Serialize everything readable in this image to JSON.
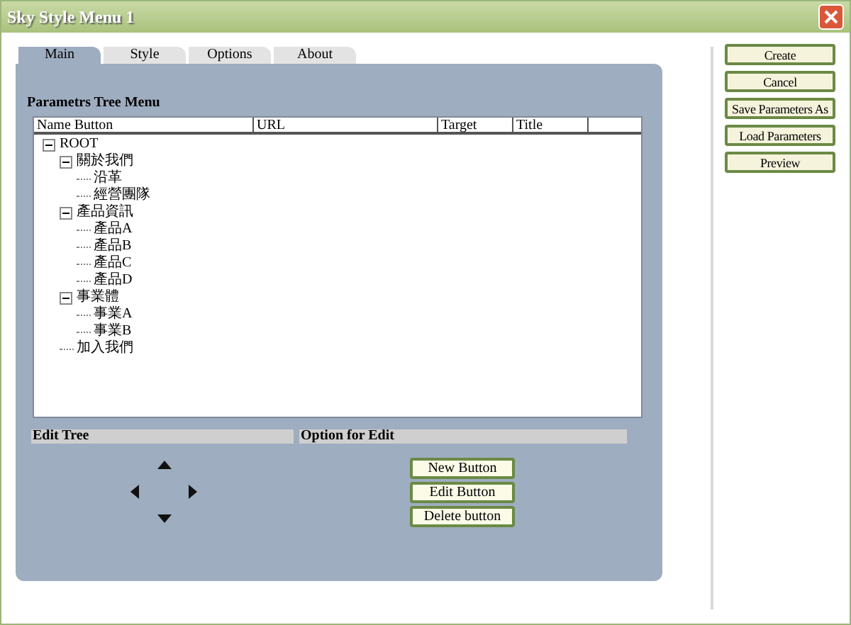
{
  "window": {
    "title": "Sky Style Menu 1"
  },
  "tabs": [
    {
      "label": "Main",
      "selected": true
    },
    {
      "label": "Style",
      "selected": false
    },
    {
      "label": "Options",
      "selected": false
    },
    {
      "label": "About",
      "selected": false
    }
  ],
  "tree_panel": {
    "title": "Parametrs Tree Menu",
    "columns": [
      "Name Button",
      "URL",
      "Target",
      "Title"
    ],
    "tree": [
      {
        "label": "ROOT",
        "expanded": true,
        "children": [
          {
            "label": "關於我們",
            "expanded": true,
            "children": [
              {
                "label": "沿革"
              },
              {
                "label": "經營團隊"
              }
            ]
          },
          {
            "label": "產品資訊",
            "expanded": true,
            "children": [
              {
                "label": "產品A"
              },
              {
                "label": "產品B"
              },
              {
                "label": "產品C"
              },
              {
                "label": "產品D"
              }
            ]
          },
          {
            "label": "事業體",
            "expanded": true,
            "children": [
              {
                "label": "事業A"
              },
              {
                "label": "事業B"
              }
            ]
          },
          {
            "label": "加入我們"
          }
        ]
      }
    ]
  },
  "edit_tree": {
    "title": "Edit Tree"
  },
  "option_for_edit": {
    "title": "Option for Edit",
    "buttons": [
      "New Button",
      "Edit Button",
      "Delete button"
    ]
  },
  "side_buttons": [
    "Create",
    "Cancel",
    "Save Parameters As",
    "Load Parameters",
    "Preview"
  ]
}
